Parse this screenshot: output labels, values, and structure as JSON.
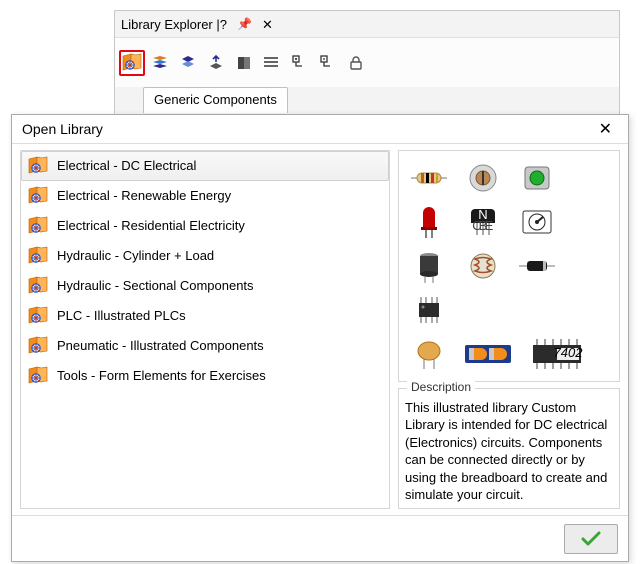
{
  "explorer": {
    "title": "Library Explorer | ",
    "tab_label": "Generic Components",
    "toolbar_icons": [
      "open-library-icon",
      "library-stack-icon",
      "layers-icon",
      "export-lib-icon",
      "book-icon",
      "list-view-icon",
      "tree-expand-icon",
      "tree-collapse-icon",
      "lock-icon"
    ]
  },
  "dialog": {
    "title": "Open Library",
    "libraries": [
      {
        "label": "Electrical - DC Electrical"
      },
      {
        "label": "Electrical - Renewable Energy"
      },
      {
        "label": "Electrical - Residential Electricity"
      },
      {
        "label": "Hydraulic - Cylinder + Load"
      },
      {
        "label": "Hydraulic - Sectional Components"
      },
      {
        "label": "PLC - Illustrated PLCs"
      },
      {
        "label": "Pneumatic - Illustrated Components"
      },
      {
        "label": "Tools - Form Elements for Exercises"
      }
    ],
    "selected_index": 0,
    "description_label": "Description",
    "description_text": "This illustrated library Custom Library is intended for DC electrical (Electronics) circuits. Components can be connected directly or by using the breadboard to create and simulate your circuit.",
    "preview_components": [
      "resistor",
      "potentiometer",
      "pushbutton-green",
      "led-red",
      "transistor",
      "rotary-dial",
      "capacitor-elec",
      "photoresistor",
      "diode",
      "ic-chip-small",
      "capacitor-ceramic",
      "battery-pack",
      "ic-7402"
    ],
    "ic_label": "7402"
  },
  "colors": {
    "highlight_border": "#e30613",
    "ok_green": "#3aa537"
  }
}
